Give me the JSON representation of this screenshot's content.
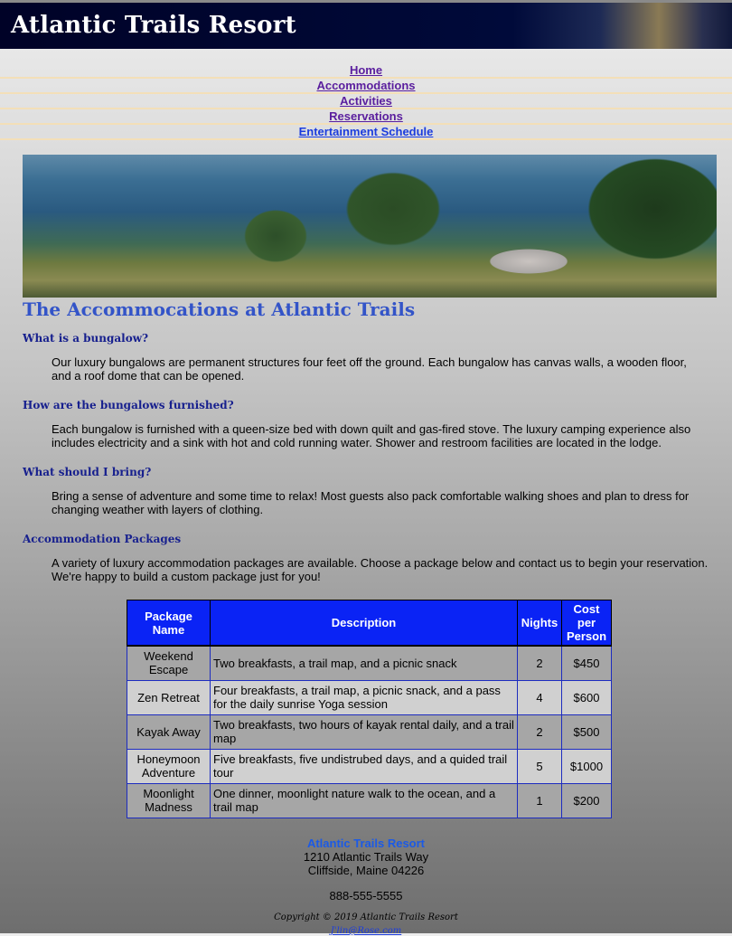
{
  "site": {
    "title": "Atlantic Trails Resort"
  },
  "nav": {
    "items": [
      {
        "label": "Home"
      },
      {
        "label": "Accommodations"
      },
      {
        "label": "Activities"
      },
      {
        "label": "Reservations"
      },
      {
        "label": "Entertainment Schedule"
      }
    ]
  },
  "main": {
    "title": "The Accommocations at Atlantic Trails",
    "sections": [
      {
        "heading": "What is a bungalow?",
        "text": "Our luxury bungalows are permanent structures four feet off the ground. Each bungalow has canvas walls, a wooden floor, and a roof dome that can be opened."
      },
      {
        "heading": "How are the bungalows furnished?",
        "text": "Each bungalow is furnished with a queen-size bed with down quilt and gas-fired stove. The luxury camping experience also includes electricity and a sink with hot and cold running water. Shower and restroom facilities are located in the lodge."
      },
      {
        "heading": "What should I bring?",
        "text": "Bring a sense of adventure and some time to relax! Most guests also pack comfortable walking shoes and plan to dress for changing weather with layers of clothing."
      },
      {
        "heading": "Accommodation Packages",
        "text": "A variety of luxury accommodation packages are available. Choose a package below and contact us to begin your reservation. We're happy to build a custom package just for you!"
      }
    ]
  },
  "table": {
    "headers": [
      "Package Name",
      "Description",
      "Nights",
      "Cost per Person"
    ],
    "rows": [
      [
        "Weekend Escape",
        "Two breakfasts, a trail map, and a picnic snack",
        "2",
        "$450"
      ],
      [
        "Zen Retreat",
        "Four breakfasts, a trail map, a picnic snack, and a pass for the daily sunrise Yoga session",
        "4",
        "$600"
      ],
      [
        "Kayak Away",
        "Two breakfasts, two hours of kayak rental daily, and a trail map",
        "2",
        "$500"
      ],
      [
        "Honeymoon Adventure",
        "Five breakfasts, five undistrubed days, and a quided trail tour",
        "5",
        "$1000"
      ],
      [
        "Moonlight Madness",
        "One dinner, moonlight nature walk to the ocean, and a trail map",
        "1",
        "$200"
      ]
    ]
  },
  "footer": {
    "name": "Atlantic Trails Resort",
    "street": "1210 Atlantic Trails Way",
    "city": "Cliffside, Maine 04226",
    "phone": "888-555-5555",
    "copyright": "Copyright © 2019 Atlantic Trails Resort",
    "email": "J'lin@Rose.com"
  }
}
